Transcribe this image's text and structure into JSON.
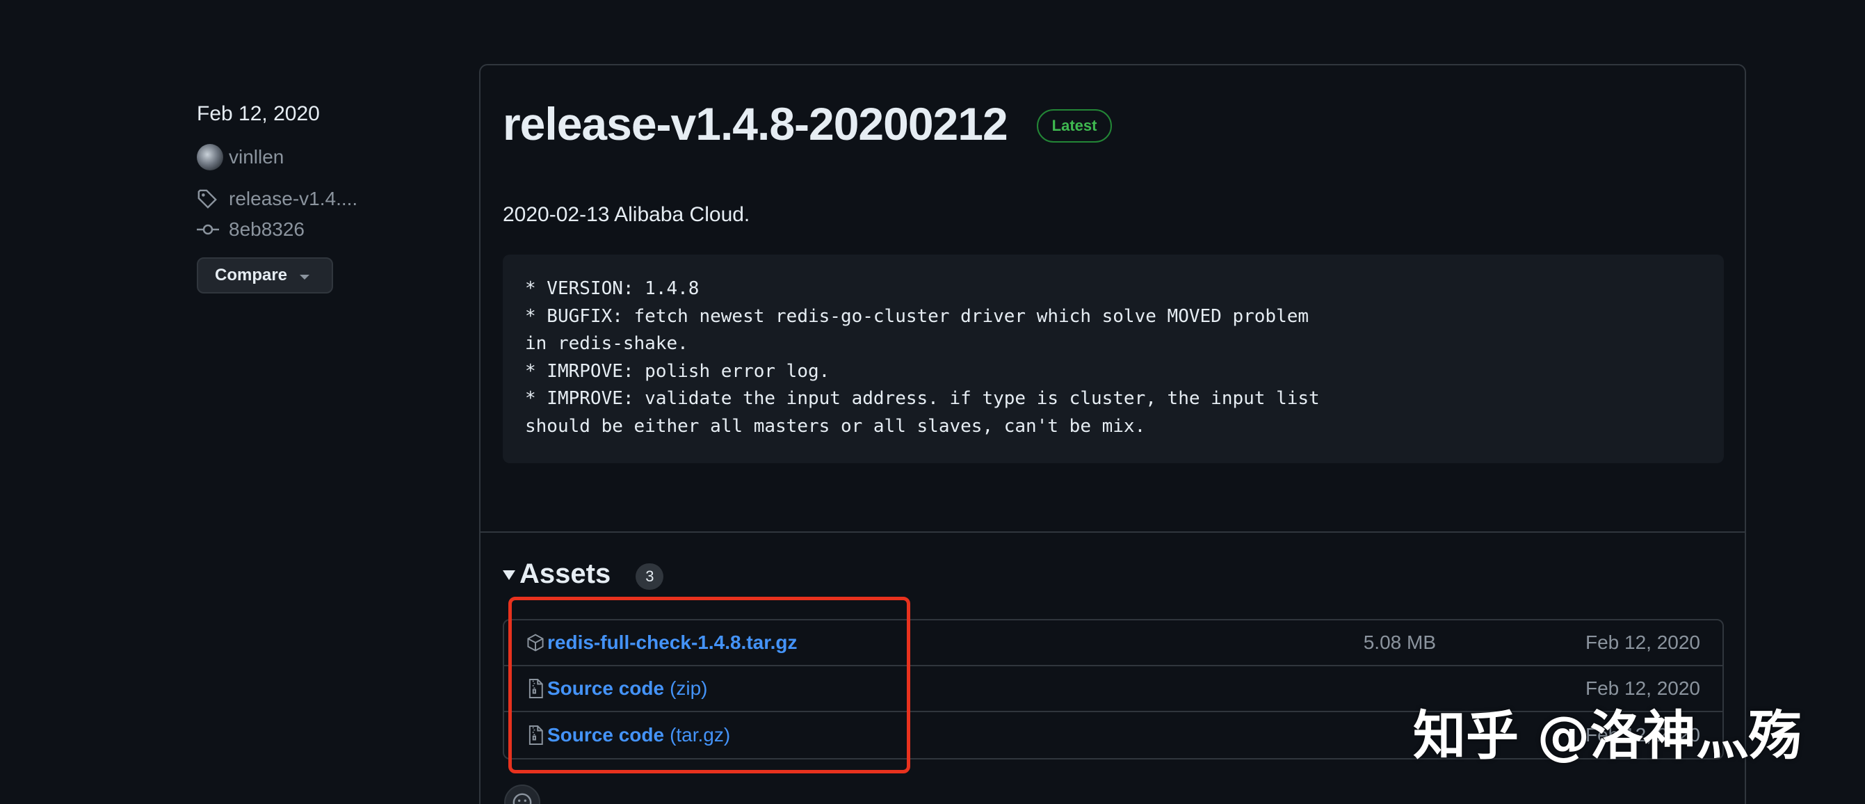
{
  "sidebar": {
    "date": "Feb 12, 2020",
    "author": "vinllen",
    "tag": "release-v1.4....",
    "commit": "8eb8326",
    "compare_label": "Compare"
  },
  "release": {
    "title": "release-v1.4.8-20200212",
    "badge": "Latest",
    "description": "2020-02-13 Alibaba Cloud.",
    "notes": "* VERSION: 1.4.8\n* BUGFIX: fetch newest redis-go-cluster driver which solve MOVED problem\nin redis-shake.\n* IMRPOVE: polish error log.\n* IMPROVE: validate the input address. if type is cluster, the input list\nshould be either all masters or all slaves, can't be mix."
  },
  "assets": {
    "label": "Assets",
    "count": "3",
    "items": [
      {
        "name": "redis-full-check-1.4.8.tar.gz",
        "suffix": "",
        "size": "5.08 MB",
        "date": "Feb 12, 2020",
        "icon": "package-icon"
      },
      {
        "name": "Source code",
        "suffix": "(zip)",
        "size": "",
        "date": "Feb 12, 2020",
        "icon": "file-zip-icon"
      },
      {
        "name": "Source code",
        "suffix": "(tar.gz)",
        "size": "",
        "date": "Feb 12, 2020",
        "icon": "file-zip-icon"
      }
    ]
  },
  "watermark": "知乎 @洛神灬殇",
  "colors": {
    "background": "#0d1117",
    "link": "#4493f8",
    "latest_badge": "#3fb950",
    "highlight": "#e8321e"
  }
}
